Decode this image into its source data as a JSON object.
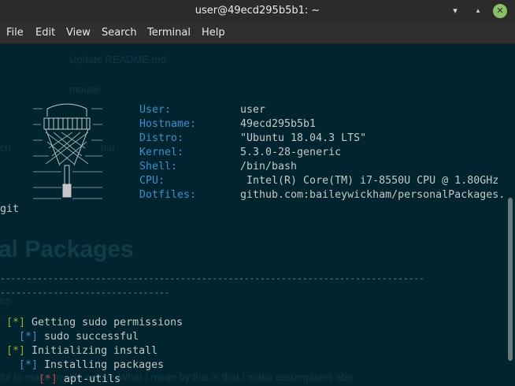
{
  "window": {
    "title": "user@49ecd295b5b1: ~",
    "controls": {
      "minimize": "▾",
      "maximize": "▴",
      "close": "✕"
    }
  },
  "menu": [
    "File",
    "Edit",
    "View",
    "Search",
    "Terminal",
    "Help"
  ],
  "background_text": {
    "top1": "Update README.md",
    "top2": "mouse",
    "left1": "ch",
    "mid1": "nal",
    "git": "git",
    "heading": "al Packages",
    "es": "es",
    "bottom": "ful to make my life easier. What I mean by this is that I make assumptions abo"
  },
  "sysinfo": [
    {
      "label": "User:",
      "value": "user"
    },
    {
      "label": "Hostname:",
      "value": "49ecd295b5b1"
    },
    {
      "label": "Distro:",
      "value": "\"Ubuntu 18.04.3 LTS\""
    },
    {
      "label": "Kernel:",
      "value": "5.3.0-28-generic"
    },
    {
      "label": "Shell:",
      "value": "/bin/bash"
    },
    {
      "label": "CPU:",
      "value": " Intel(R) Core(TM) i7-8550U CPU @ 1.80GHz"
    },
    {
      "label": "Dotfiles:",
      "value": "github.com:baileywickham/personalPackages."
    }
  ],
  "divider": {
    "line1": "--------------------------------------------------------------------------------",
    "line2": "--------------------------------"
  },
  "log": [
    {
      "indent": "  ",
      "mark": "[*]",
      "color": "yellow",
      "text": "Getting sudo permissions"
    },
    {
      "indent": "    ",
      "mark": "[*]",
      "color": "blue",
      "text": "sudo successful"
    },
    {
      "indent": "  ",
      "mark": "[*]",
      "color": "yellow",
      "text": "Initializing install"
    },
    {
      "indent": "    ",
      "mark": "[*]",
      "color": "blue",
      "text": "Installing packages"
    },
    {
      "indent": "      ",
      "mark": "[*]",
      "color": "red",
      "text": "apt-utils"
    }
  ],
  "colors": {
    "terminal_bg": "#00252f",
    "label_blue": "#3b8fd0",
    "bullet_yellow": "#a4a81e",
    "bullet_red": "#c93c3c"
  }
}
